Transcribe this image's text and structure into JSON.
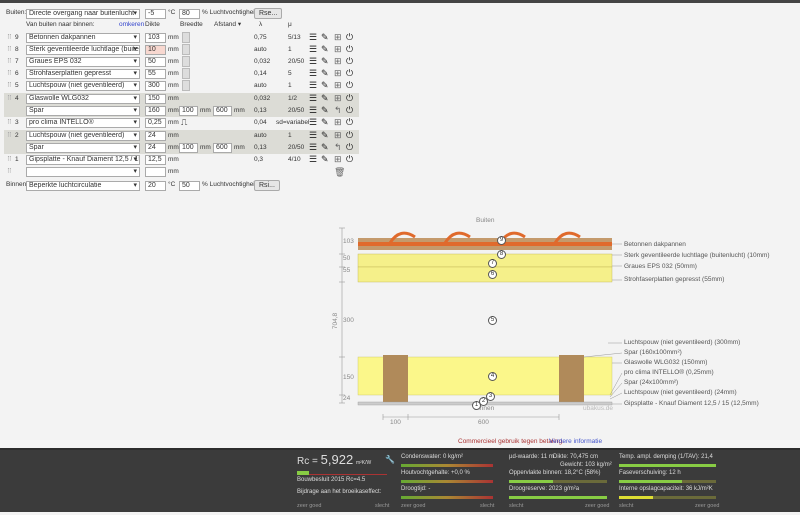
{
  "outside": {
    "label": "Buiten:",
    "condition": "Directe overgang naar buitenlucht",
    "temp": "-5",
    "temp_unit": "°C",
    "humidity": "80",
    "humidity_unit": "% Luchtvochtigheid",
    "button": "Rse..."
  },
  "header": {
    "order": "Van buiten naar binnen:",
    "reverse": "omkeren",
    "thickness": "Dikte",
    "width": "Breedte",
    "distance": "Afstand ▾",
    "lambda": "λ",
    "mu": "μ"
  },
  "unit": "mm",
  "layers": [
    {
      "num": "9",
      "name": "Betonnen dakpannen",
      "d": "103",
      "lambda": "0,75",
      "mu": "5/13"
    },
    {
      "num": "8",
      "name": "Sterk geventileerde luchtlage (buitenlucht)",
      "d": "10",
      "lambda": "auto",
      "mu": "1",
      "warn": true
    },
    {
      "num": "7",
      "name": "Graues EPS  032",
      "d": "50",
      "lambda": "0,032",
      "mu": "20/50"
    },
    {
      "num": "6",
      "name": "Strohfaserplatten gepresst",
      "d": "55",
      "lambda": "0,14",
      "mu": "5"
    },
    {
      "num": "5",
      "name": "Luchtspouw (niet geventileerd)",
      "d": "300",
      "lambda": "auto",
      "mu": "1"
    },
    {
      "num": "4",
      "name": "Glaswolle WLG032",
      "d": "150",
      "lambda": "0,032",
      "mu": "1/2",
      "gray": true
    },
    {
      "num": "",
      "name": "Spar",
      "d": "160",
      "w": "100",
      "a": "600",
      "lambda": "0,13",
      "mu": "20/50",
      "gray": true,
      "sub": true
    },
    {
      "num": "3",
      "name": "pro clima INTELLO®",
      "d": "0,25",
      "lambda": "0,04",
      "mu": "sd=variabel",
      "foil": true
    },
    {
      "num": "2",
      "name": "Luchtspouw (niet geventileerd)",
      "d": "24",
      "lambda": "auto",
      "mu": "1",
      "gray": true
    },
    {
      "num": "",
      "name": "Spar",
      "d": "24",
      "w": "100",
      "a": "600",
      "lambda": "0,13",
      "mu": "20/50",
      "gray": true,
      "sub": true
    },
    {
      "num": "1",
      "name": "Gipsplatte - Knauf Diament 12,5 / 15",
      "d": "12,5",
      "lambda": "0,3",
      "mu": "4/10"
    },
    {
      "num": "",
      "name": "",
      "d": "",
      "lambda": "",
      "mu": "",
      "empty": true
    }
  ],
  "inside": {
    "label": "Binnen:",
    "condition": "Beperkte luchtcirculatie",
    "temp": "20",
    "temp_unit": "°C",
    "humidity": "50",
    "humidity_unit": "% Luchtvochtigheid",
    "button": "Rsi..."
  },
  "diagram": {
    "top": "Buiten",
    "bottom": "Binnen",
    "total": "704,8",
    "dims": [
      "103",
      "50",
      "55",
      "300",
      "150",
      "24"
    ],
    "widths": [
      "100",
      "600"
    ],
    "watermark": "ubakus.de",
    "labels": [
      "Betonnen dakpannen",
      "Sterk geventileerde luchtlage (buitenlucht) (10mm)",
      "Graues EPS  032 (50mm)",
      "Strohfaserplatten gepresst (55mm)",
      "Luchtspouw (niet geventileerd) (300mm)",
      "Spar (160x100mm²)",
      "Glaswolle WLG032 (150mm)",
      "pro clima INTELLO® (0,25mm)",
      "Spar (24x100mm²)",
      "Luchtspouw (niet geventileerd) (24mm)",
      "Gipsplatte - Knauf Diament 12,5 / 15 (12,5mm)"
    ],
    "markers": [
      "9",
      "8",
      "7",
      "6",
      "5",
      "4",
      "3",
      "2",
      "1"
    ]
  },
  "notice": {
    "text": "Commercieel gebruik tegen betaling.",
    "link": "Verdere informatie"
  },
  "results": {
    "rc_label": "Rc",
    "rc_eq": "=",
    "rc": "5,922",
    "rc_unit": "m²K/W",
    "norm": "Bouwbesluit 2015 Rc=4.5",
    "greenhouse": "Bijdrage aan het broeikaseffect:",
    "condensation": "Condenswater: 0 kg/m²",
    "wood": "Houtvochtgehalte: +0,0 %",
    "drying": "Droogtijd: -",
    "sd": "µd-waarde: 11 m",
    "thickness": "Dikte: 70,475 cm",
    "weight": "Gewicht: 103 kg/m²",
    "surface": "Oppervlakte binnen: 18,2°C (58%)",
    "reserve": "Droogreserve: 2023 g/m²a",
    "tav": "Temp. ampl. demping (1/TAV): 21,4",
    "phase": "Faseverschuiving: 12 h",
    "capacity": "Interne opslagcapaciteit: 36 kJ/m²K",
    "good": "zeer goed",
    "bad": "slecht"
  }
}
